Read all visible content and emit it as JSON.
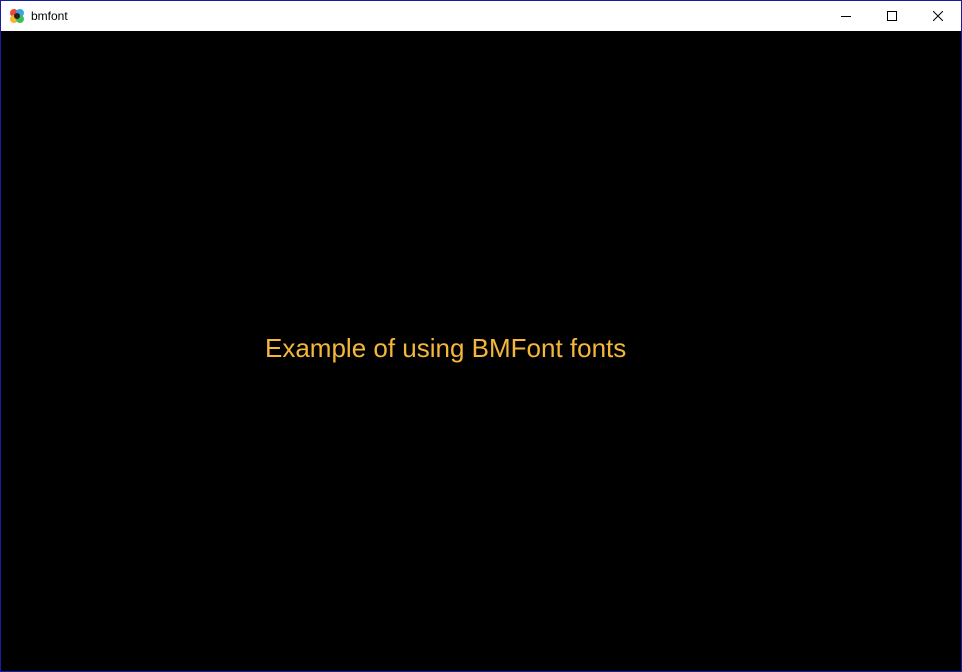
{
  "window": {
    "title": "bmfont",
    "controls": {
      "minimize_icon": "minimize-icon",
      "maximize_icon": "maximize-icon",
      "close_icon": "close-icon"
    }
  },
  "content": {
    "text": "Example of using BMFont fonts",
    "text_color": "#f5b73b",
    "background": "#000000"
  },
  "colors": {
    "window_border": "#1a1aa6",
    "titlebar": "#ffffff"
  }
}
